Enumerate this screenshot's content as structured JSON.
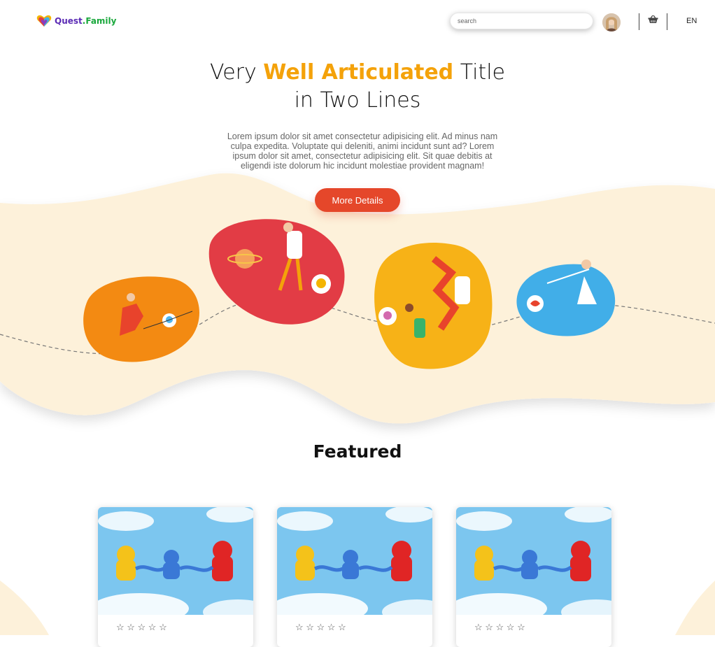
{
  "header": {
    "logo_text_1": "Quest",
    "logo_text_2": ".Family",
    "search_placeholder": "search",
    "language": "EN"
  },
  "hero": {
    "title_pre": "Very ",
    "title_highlight": "Well Articulated",
    "title_post": " Title",
    "title_line2": "in Two Lines",
    "description": "Lorem ipsum dolor sit amet consectetur adipisicing elit. Ad minus nam culpa expedita. Voluptate qui deleniti, animi incidunt sunt ad? Lorem ipsum dolor sit amet, consectetur adipisicing elit. Sit quae debitis at eligendi iste dolorum hic incidunt molestiae provident magnam!",
    "cta_label": "More Details"
  },
  "featured": {
    "heading": "Featured",
    "cards": [
      {
        "stars": "☆ ☆ ☆ ☆ ☆"
      },
      {
        "stars": "☆ ☆ ☆ ☆ ☆"
      },
      {
        "stars": "☆ ☆ ☆ ☆ ☆"
      }
    ]
  },
  "colors": {
    "accent": "#f4a20a",
    "cta": "#e5472a",
    "wave": "#fdf1da"
  },
  "icons": [
    "heart-logo-icon",
    "basket-icon",
    "star-icon"
  ]
}
